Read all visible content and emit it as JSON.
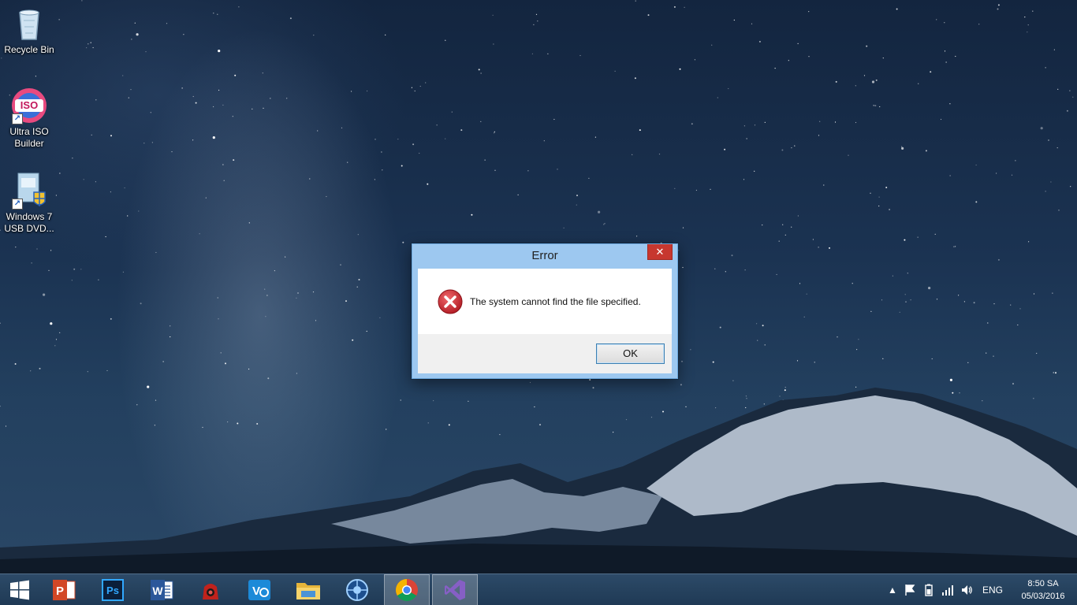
{
  "desktop": {
    "icons": [
      {
        "label": "Recycle Bin"
      },
      {
        "label": "Ultra ISO Builder",
        "badge": "ISO"
      },
      {
        "label": "Windows 7 USB DVD..."
      }
    ]
  },
  "dialog": {
    "title": "Error",
    "close_label": "✕",
    "message": "The system cannot find the file specified.",
    "ok_label": "OK"
  },
  "taskbar": {
    "items": [
      {
        "icon": "windows-start-icon"
      },
      {
        "icon": "powerpoint-icon",
        "glyph": "P"
      },
      {
        "icon": "photoshop-icon",
        "glyph": "Ps"
      },
      {
        "icon": "word-icon",
        "glyph": "W"
      },
      {
        "icon": "red-app-icon"
      },
      {
        "icon": "vscode-icon",
        "glyph": "V"
      },
      {
        "icon": "file-explorer-icon"
      },
      {
        "icon": "media-app-icon"
      },
      {
        "icon": "chrome-icon"
      },
      {
        "icon": "visual-studio-icon"
      }
    ],
    "tray": {
      "language": "ENG",
      "time": "8:50 SA",
      "date": "05/03/2016"
    }
  },
  "colors": {
    "dialog_frame": "#9dc8f0",
    "close_red": "#c7372f",
    "error_red": "#c9242b",
    "taskbar": "#2a4b6e"
  }
}
